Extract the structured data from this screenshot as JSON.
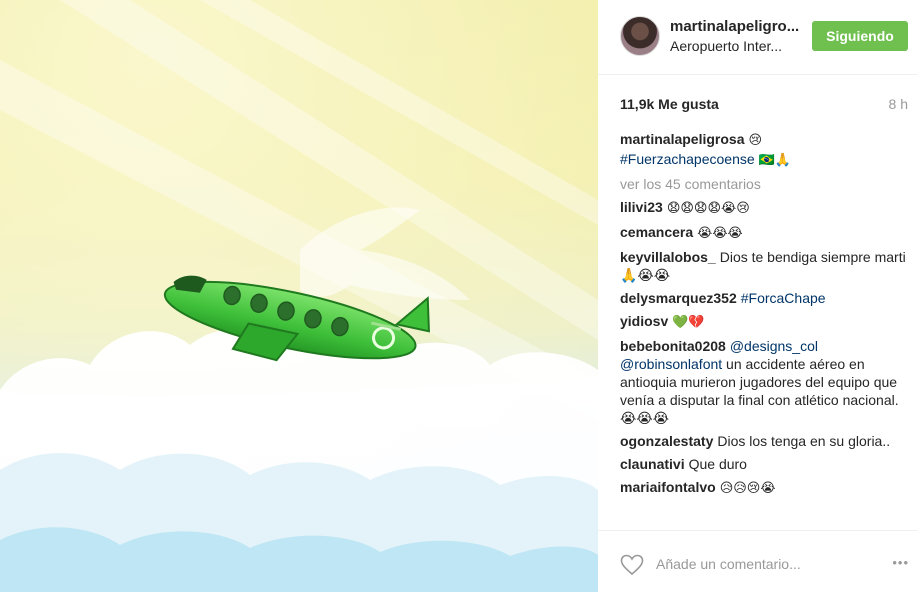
{
  "post": {
    "username": "martinalapeligro...",
    "location": "Aeropuerto Inter...",
    "follow_label": "Siguiendo",
    "likes": "11,9k Me gusta",
    "time": "8 h"
  },
  "caption": {
    "user": "martinalapeligrosa",
    "emoji": "😢",
    "hashtag": "#Fuerzachapecoense",
    "emoji2": "🇧🇷🙏"
  },
  "view_more": "ver los 45 comentarios",
  "comments": [
    {
      "user": "lilivi23",
      "text": "😧😧😧😧😭😢"
    },
    {
      "user": "cemancera",
      "text": "😭😭😭"
    },
    {
      "user": "keyvillalobos_",
      "text": "Dios te bendiga siempre marti🙏😭😭"
    },
    {
      "user": "delysmarquez352",
      "link": "#ForcaChape"
    },
    {
      "user": "yidiosv",
      "text": "💚💔"
    },
    {
      "user": "bebebonita0208",
      "mention1": "@designs_col",
      "mention2": "@robinsonlafont",
      "text": " un accidente aéreo en antioquia murieron jugadores del equipo que venía a disputar la final con atlético nacional. 😭😭😭"
    },
    {
      "user": "ogonzalestaty",
      "text": "Dios los tenga en su gloria.."
    },
    {
      "user": "claunativi",
      "text": "Que duro"
    },
    {
      "user": "mariaifontalvo",
      "text": "😥😥😢😭"
    }
  ],
  "footer": {
    "placeholder": "Añade un comentario...",
    "more_icon": "•••"
  },
  "colors": {
    "follow_green": "#70c050",
    "plane_green": "#3fc03a",
    "link_blue": "#003569"
  },
  "icons": [
    "heart-icon",
    "more-options-icon"
  ]
}
